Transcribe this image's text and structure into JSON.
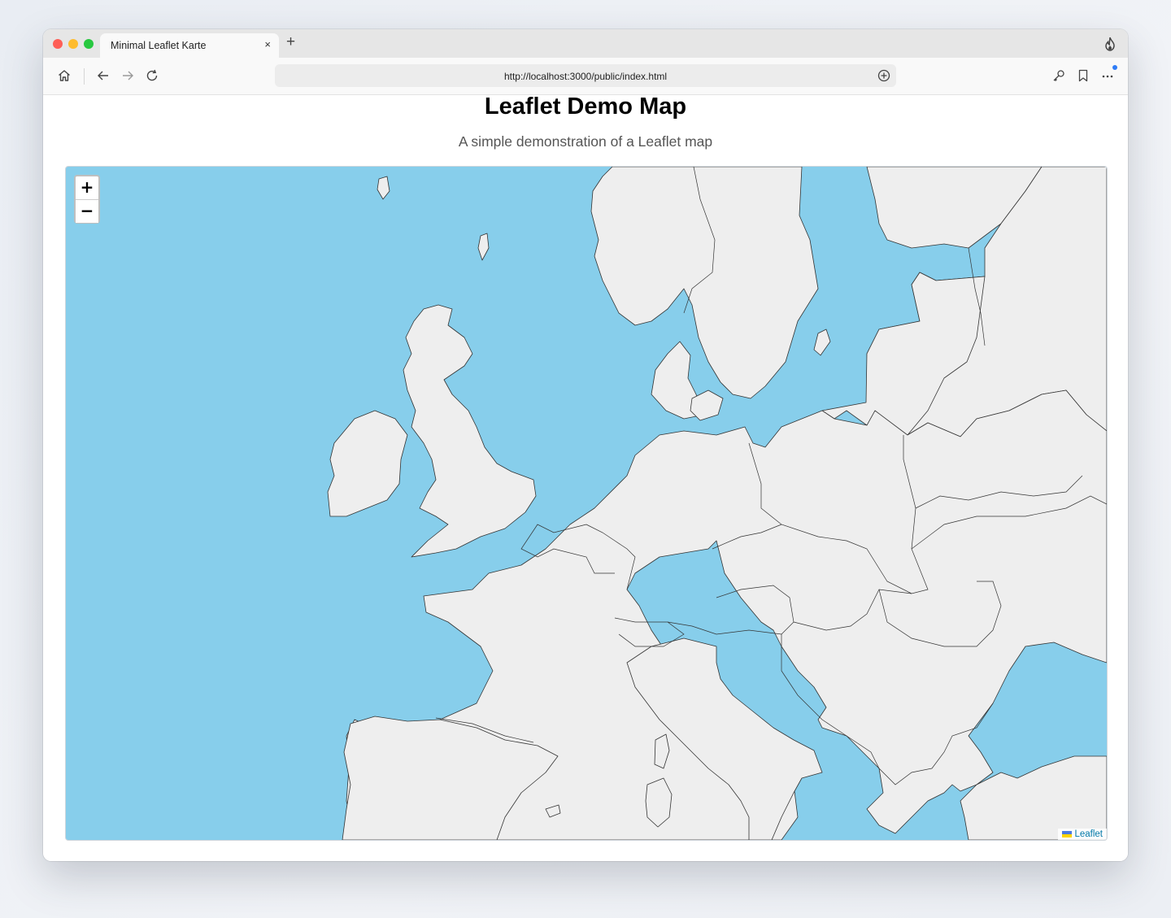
{
  "browser": {
    "tab_title": "Minimal Leaflet Karte",
    "tab_close": "×",
    "new_tab": "+",
    "url": "http://localhost:3000/public/index.html"
  },
  "page": {
    "title": "Leaflet Demo Map",
    "subtitle": "A simple demonstration of a Leaflet map"
  },
  "map": {
    "zoom_in": "+",
    "zoom_out": "−",
    "attribution": "Leaflet",
    "colors": {
      "sea": "#87ceeb",
      "land": "#eeeeee",
      "border": "#333333"
    }
  }
}
